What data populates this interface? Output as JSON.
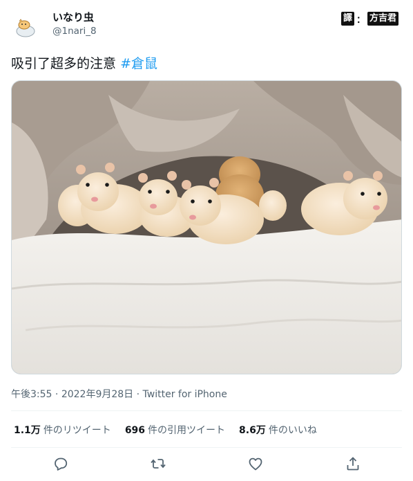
{
  "user": {
    "display_name": "いなり虫",
    "handle": "@1nari_8",
    "avatar_icon": "hamster-icon"
  },
  "watermark": {
    "left": "譯",
    "sep": "：",
    "right": "方吉君"
  },
  "tweet": {
    "text": "吸引了超多的注意",
    "hashtag": "#倉鼠",
    "image_alt": "hamster-babies-photo"
  },
  "meta": {
    "time": "午後3:55",
    "dot1": " · ",
    "date": "2022年9月28日",
    "dot2": " · ",
    "client": "Twitter for iPhone"
  },
  "stats": {
    "retweets_count": "1.1万",
    "retweets_label": "件のリツイート",
    "quotes_count": "696",
    "quotes_label": "件の引用ツイート",
    "likes_count": "8.6万",
    "likes_label": "件のいいね"
  },
  "actions": [
    "reply-icon",
    "retweet-icon",
    "like-icon",
    "share-icon"
  ],
  "colors": {
    "accent": "#1d9bf0",
    "text": "#0f1419",
    "secondary": "#536471"
  }
}
